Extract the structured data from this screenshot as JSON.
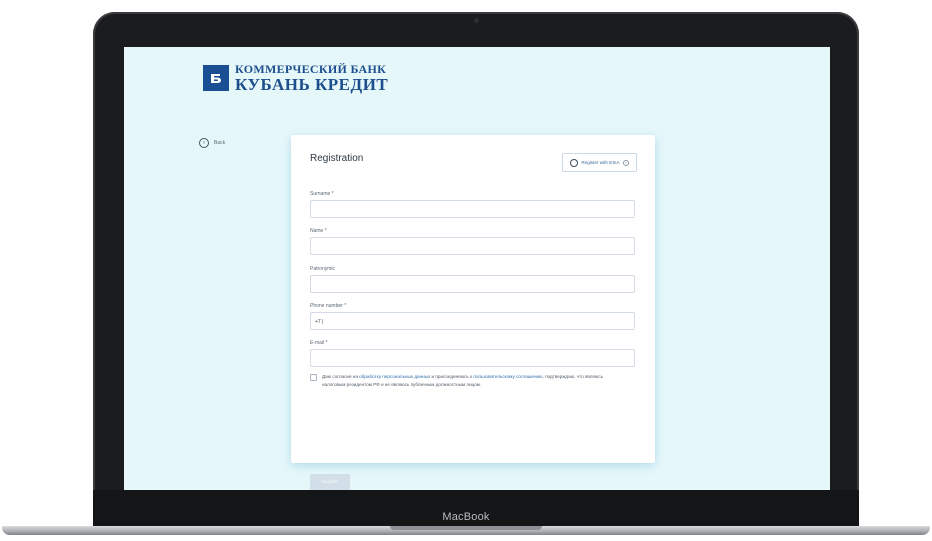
{
  "device": {
    "brand": "MacBook"
  },
  "logo": {
    "line1": "КОММЕРЧЕСКИЙ БАНК",
    "line2": "КУБАНЬ КРЕДИТ"
  },
  "nav": {
    "back_label": "Back"
  },
  "form": {
    "title": "Registration",
    "esia_button": "Register with ESIA",
    "fields": {
      "surname": {
        "label": "Surname *",
        "value": ""
      },
      "name": {
        "label": "Name *",
        "value": ""
      },
      "patronymic": {
        "label": "Patronymic",
        "value": ""
      },
      "phone": {
        "label": "Phone number *",
        "value": "+7 |"
      },
      "email": {
        "label": "E-mail *",
        "value": ""
      }
    },
    "consent": {
      "part1": "Даю согласие на ",
      "link1": "обработку персональных данных",
      "part2": " и присоединяюсь к ",
      "link2": "пользовательскому соглашению",
      "part3": ", подтверждаю, что являюсь налоговым резидентом РФ и не являюсь публичным должностным лицом."
    },
    "submit_label": "Register"
  },
  "colors": {
    "screen_bg": "#e6f7fa",
    "brand_blue": "#1d4f8d",
    "link": "#2f6ea8",
    "button_disabled": "#d2dfe8"
  }
}
